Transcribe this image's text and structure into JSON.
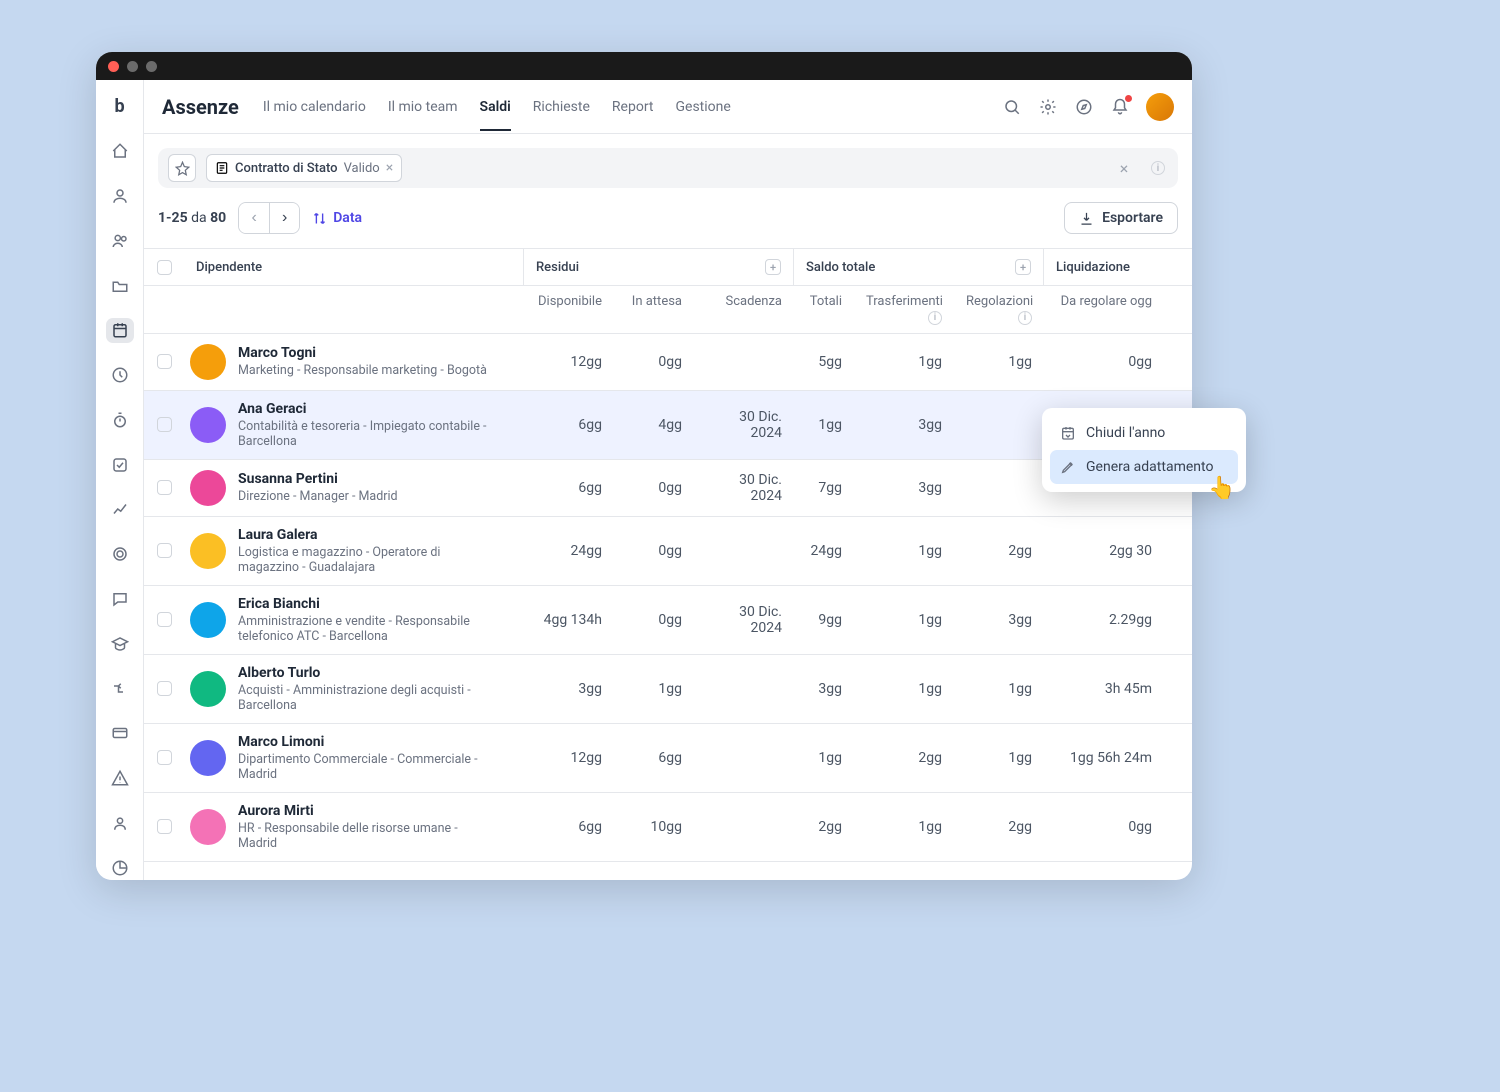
{
  "page_title": "Assenze",
  "tabs": [
    "Il mio calendario",
    "Il mio team",
    "Saldi",
    "Richieste",
    "Report",
    "Gestione"
  ],
  "active_tab": "Saldi",
  "filter": {
    "field": "Contratto di Stato",
    "value": "Valido"
  },
  "pagination": {
    "range": "1-25",
    "of_label": "da",
    "total": "80"
  },
  "sort_label": "Data",
  "export_label": "Esportare",
  "column_groups": {
    "employee": "Dipendente",
    "residui": "Residui",
    "saldo": "Saldo totale",
    "liquidazione": "Liquidazione"
  },
  "columns": {
    "available": "Disponibile",
    "pending": "In attesa",
    "expiry": "Scadenza",
    "total": "Totali",
    "transfers": "Trasferimenti",
    "adjustments": "Regolazioni",
    "to_settle": "Da regolare ogg"
  },
  "rows": [
    {
      "name": "Marco Togni",
      "sub": "Marketing - Responsabile marketing - Bogotà",
      "available": "12gg",
      "pending": "0gg",
      "expiry": "",
      "total": "5gg",
      "transfers": "1gg",
      "adjustments": "1gg",
      "to_settle": "0gg"
    },
    {
      "name": "Ana Geraci",
      "sub": "Contabilità e tesoreria - Impiegato contabile - Barcellona",
      "available": "6gg",
      "pending": "4gg",
      "expiry": "30 Dic. 2024",
      "total": "1gg",
      "transfers": "3gg",
      "adjustments": "",
      "to_settle": ""
    },
    {
      "name": "Susanna Pertini",
      "sub": "Direzione - Manager - Madrid",
      "available": "6gg",
      "pending": "0gg",
      "expiry": "30 Dic. 2024",
      "total": "7gg",
      "transfers": "3gg",
      "adjustments": "",
      "to_settle": ""
    },
    {
      "name": "Laura Galera",
      "sub": "Logistica e magazzino - Operatore di magazzino - Guadalajara",
      "available": "24gg",
      "pending": "0gg",
      "expiry": "",
      "total": "24gg",
      "transfers": "1gg",
      "adjustments": "2gg",
      "to_settle": "2gg 30"
    },
    {
      "name": "Erica Bianchi",
      "sub": "Amministrazione e vendite - Responsabile telefonico ATC - Barcellona",
      "available": "4gg 134h",
      "pending": "0gg",
      "expiry": "30 Dic. 2024",
      "total": "9gg",
      "transfers": "1gg",
      "adjustments": "3gg",
      "to_settle": "2.29gg"
    },
    {
      "name": "Alberto Turlo",
      "sub": "Acquisti - Amministrazione degli acquisti - Barcellona",
      "available": "3gg",
      "pending": "1gg",
      "expiry": "",
      "total": "3gg",
      "transfers": "1gg",
      "adjustments": "1gg",
      "to_settle": "3h 45m"
    },
    {
      "name": "Marco Limoni",
      "sub": "Dipartimento Commerciale - Commerciale - Madrid",
      "available": "12gg",
      "pending": "6gg",
      "expiry": "",
      "total": "1gg",
      "transfers": "2gg",
      "adjustments": "1gg",
      "to_settle": "1gg 56h 24m"
    },
    {
      "name": "Aurora Mirti",
      "sub": "HR - Responsabile delle risorse umane - Madrid",
      "available": "6gg",
      "pending": "10gg",
      "expiry": "",
      "total": "2gg",
      "transfers": "1gg",
      "adjustments": "2gg",
      "to_settle": "0gg"
    }
  ],
  "context_menu": {
    "close_year": "Chiudi l'anno",
    "generate_adjustment": "Genera adattamento"
  },
  "avatars": [
    "#f59e0b",
    "#8b5cf6",
    "#ec4899",
    "#fbbf24",
    "#0ea5e9",
    "#10b981",
    "#6366f1",
    "#f472b6"
  ]
}
